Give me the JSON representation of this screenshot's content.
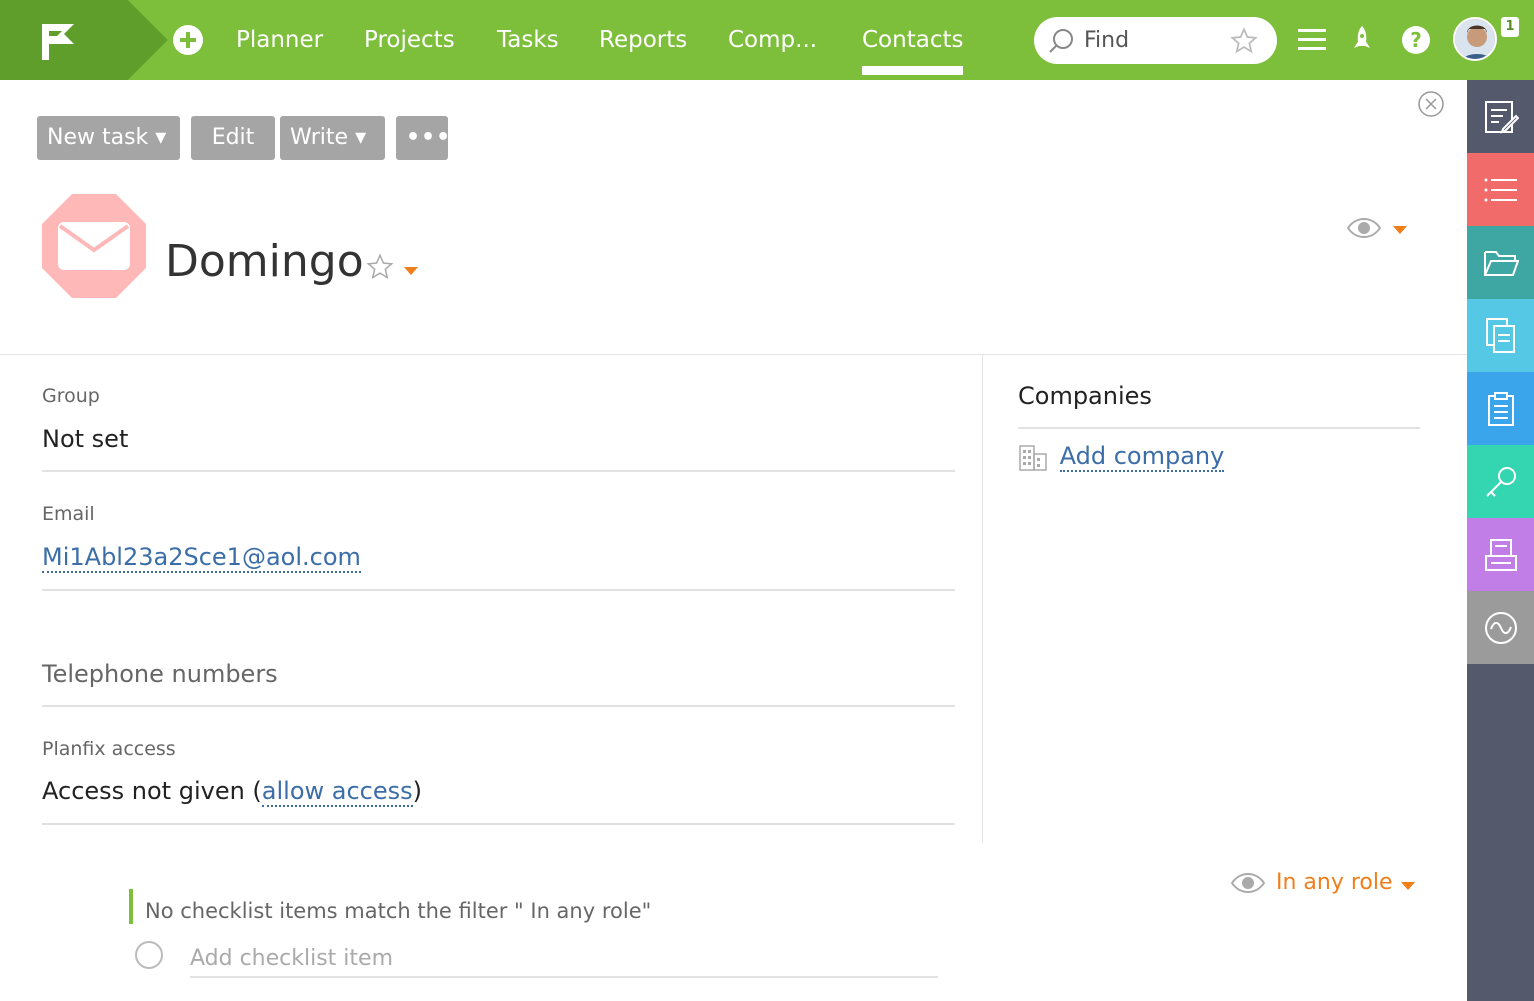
{
  "colors": {
    "topbar": "#7dbf3b",
    "topbar_dark": "#5f9e2a",
    "rail": "#545a6c",
    "accent_orange": "#f07e1b",
    "link": "#3b6ea8",
    "contact_icon": "#ffb8b8"
  },
  "topbar": {
    "nav": [
      {
        "label": "Planner"
      },
      {
        "label": "Projects"
      },
      {
        "label": "Tasks"
      },
      {
        "label": "Reports"
      },
      {
        "label": "Comp..."
      },
      {
        "label": "Contacts",
        "active": true
      }
    ],
    "search_placeholder": "Find",
    "notification_count": "1"
  },
  "rail": {
    "items": [
      {
        "icon": "edit-note-icon",
        "color": "#545a6c"
      },
      {
        "icon": "list-icon",
        "color": "#f26b6b"
      },
      {
        "icon": "folder-icon",
        "color": "#3fa7a3"
      },
      {
        "icon": "documents-icon",
        "color": "#55c8e6"
      },
      {
        "icon": "clipboard-icon",
        "color": "#3aa5ea"
      },
      {
        "icon": "key-icon",
        "color": "#33d6b0"
      },
      {
        "icon": "printer-icon",
        "color": "#c07ee6"
      },
      {
        "icon": "wave-icon",
        "color": "#9b9b9b"
      }
    ]
  },
  "toolbar": {
    "new_task": "New task  ▾",
    "edit": "Edit",
    "write": "Write  ▾",
    "more": "•••"
  },
  "contact": {
    "name": "Domingo"
  },
  "fields": {
    "group_label": "Group",
    "group_value": "Not set",
    "email_label": "Email",
    "email_value": "Mi1Abl23a2Sce1@aol.com",
    "phones_label": "Telephone numbers",
    "access_label": "Planfix access",
    "access_value": "Access not given (",
    "access_link": "allow access",
    "access_close": ")"
  },
  "companies": {
    "title": "Companies",
    "add_label": "Add company"
  },
  "checklist": {
    "role_filter": "In any role",
    "empty_message": "No checklist items match the filter \" In any role\"",
    "add_placeholder": "Add checklist item"
  }
}
